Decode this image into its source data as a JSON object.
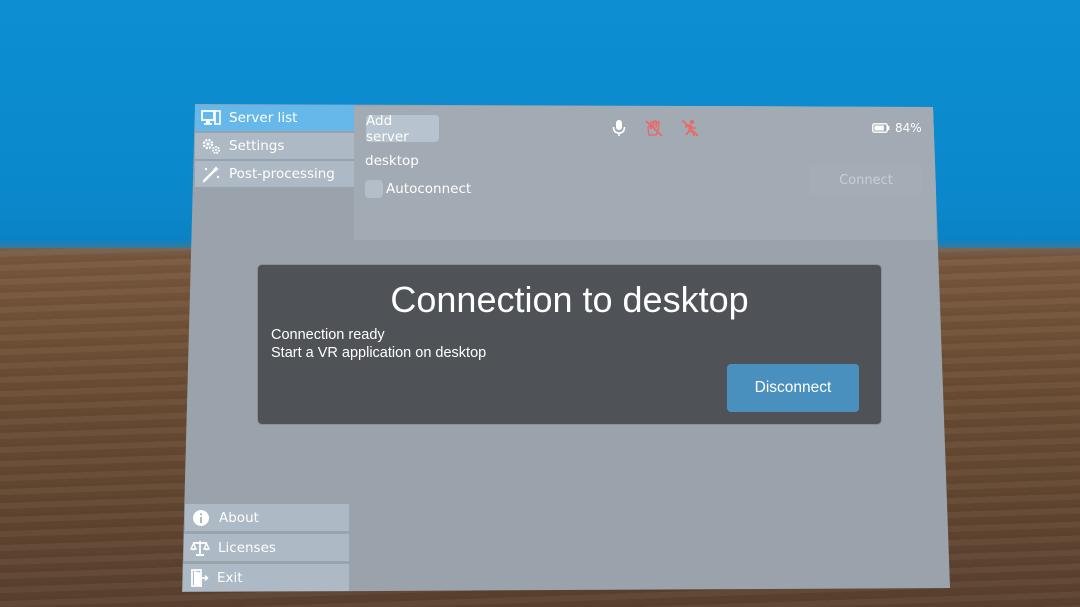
{
  "sidebar": {
    "items": [
      {
        "label": "Server list",
        "icon": "monitor-icon",
        "active": true
      },
      {
        "label": "Settings",
        "icon": "gears-icon",
        "active": false
      },
      {
        "label": "Post-processing",
        "icon": "magic-wand-icon",
        "active": false
      }
    ],
    "bottom": [
      {
        "label": "About",
        "icon": "info-icon"
      },
      {
        "label": "Licenses",
        "icon": "scale-icon"
      },
      {
        "label": "Exit",
        "icon": "exit-door-icon"
      }
    ]
  },
  "topbar": {
    "add_server_label": "Add server",
    "icons": [
      "microphone-icon",
      "hand-tracking-disabled-icon",
      "body-tracking-disabled-icon"
    ],
    "battery_text": "84%",
    "battery_level": 0.84
  },
  "server": {
    "name": "desktop",
    "autoconnect_label": "Autoconnect",
    "autoconnect_checked": false,
    "connect_label": "Connect"
  },
  "dialog": {
    "title": "Connection to desktop",
    "line1": "Connection ready",
    "line2": "Start a VR application on desktop",
    "disconnect_label": "Disconnect"
  },
  "colors": {
    "sky": "#0b88cc",
    "panel": "#9aa3ab",
    "active_nav": "#66b8ea",
    "dialog_bg": "#4f5256",
    "disconnect_button": "#4a90bf",
    "disabled_icon": "#e86a6a"
  }
}
